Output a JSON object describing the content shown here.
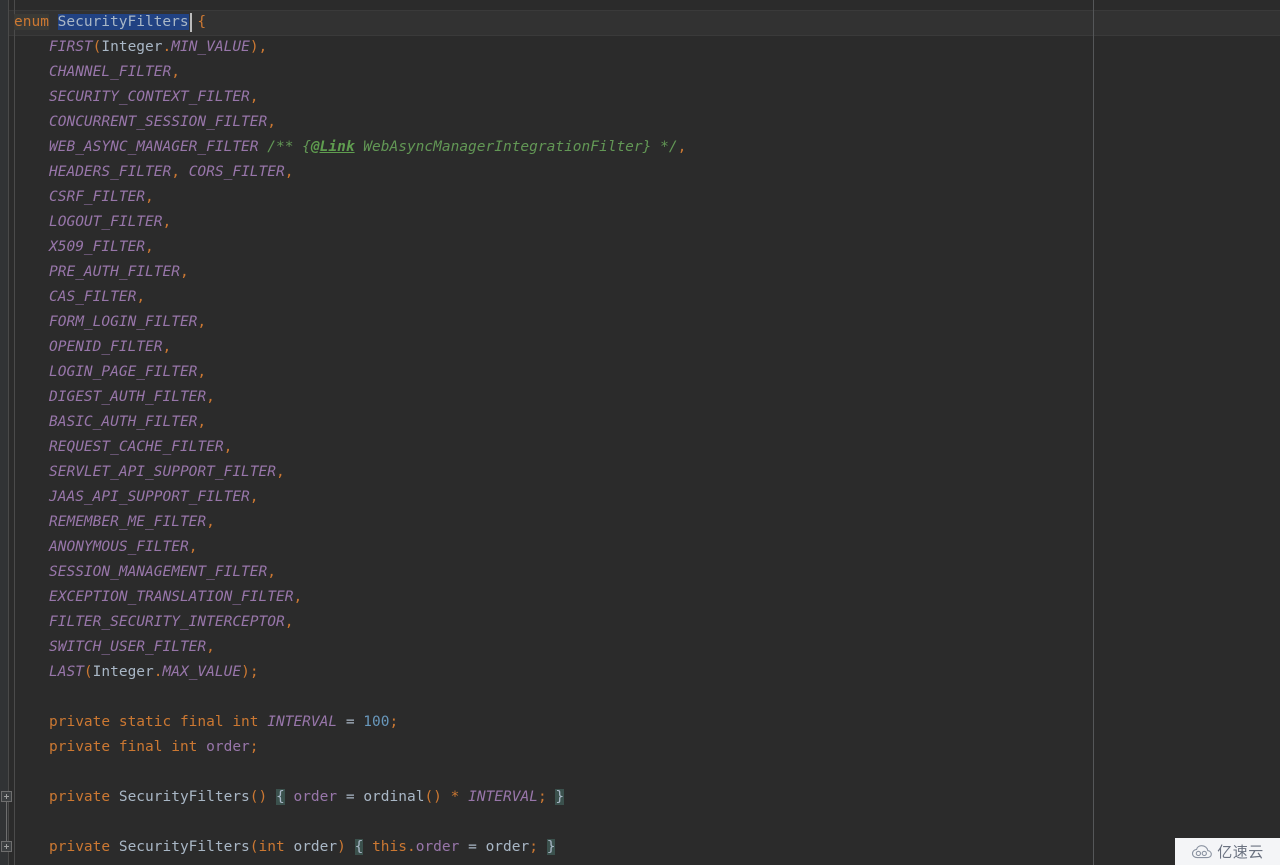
{
  "editor": {
    "language": "Java",
    "theme": "Darcula",
    "background_color": "#2b2b2b",
    "gutter_color": "#313335",
    "caret_line_color": "#323232",
    "selection_color": "#214283",
    "default_text_color": "#a9b7c6",
    "keyword_color": "#cc7832",
    "constant_color": "#9876aa",
    "number_color": "#6897bb",
    "comment_color": "#629755",
    "javadoc_tag_color": "#5f9d4f"
  },
  "declaration": {
    "keyword": "enum",
    "type_name": "SecurityFilters",
    "open_brace": "{",
    "selected_text": "SecurityFilters"
  },
  "enum_constants": [
    {
      "name": "FIRST",
      "args_prefix": "(",
      "arg_class": "Integer",
      "arg_dot": ".",
      "arg_const": "MIN_VALUE",
      "args_suffix": ")",
      "separator": ","
    },
    {
      "name": "CHANNEL_FILTER",
      "separator": ","
    },
    {
      "name": "SECURITY_CONTEXT_FILTER",
      "separator": ","
    },
    {
      "name": "CONCURRENT_SESSION_FILTER",
      "separator": ","
    },
    {
      "name": "WEB_ASYNC_MANAGER_FILTER",
      "comment_open": "/** {",
      "comment_tag": "@Link",
      "comment_body": " WebAsyncManagerIntegrationFilter",
      "comment_close": "} */",
      "separator": ","
    },
    {
      "name": "HEADERS_FILTER",
      "separator": ",",
      "extra_name": "CORS_FILTER",
      "extra_separator": ","
    },
    {
      "name": "CSRF_FILTER",
      "separator": ","
    },
    {
      "name": "LOGOUT_FILTER",
      "separator": ","
    },
    {
      "name": "X509_FILTER",
      "separator": ","
    },
    {
      "name": "PRE_AUTH_FILTER",
      "separator": ","
    },
    {
      "name": "CAS_FILTER",
      "separator": ","
    },
    {
      "name": "FORM_LOGIN_FILTER",
      "separator": ","
    },
    {
      "name": "OPENID_FILTER",
      "separator": ","
    },
    {
      "name": "LOGIN_PAGE_FILTER",
      "separator": ","
    },
    {
      "name": "DIGEST_AUTH_FILTER",
      "separator": ","
    },
    {
      "name": "BASIC_AUTH_FILTER",
      "separator": ","
    },
    {
      "name": "REQUEST_CACHE_FILTER",
      "separator": ","
    },
    {
      "name": "SERVLET_API_SUPPORT_FILTER",
      "separator": ","
    },
    {
      "name": "JAAS_API_SUPPORT_FILTER",
      "separator": ","
    },
    {
      "name": "REMEMBER_ME_FILTER",
      "separator": ","
    },
    {
      "name": "ANONYMOUS_FILTER",
      "separator": ","
    },
    {
      "name": "SESSION_MANAGEMENT_FILTER",
      "separator": ","
    },
    {
      "name": "EXCEPTION_TRANSLATION_FILTER",
      "separator": ","
    },
    {
      "name": "FILTER_SECURITY_INTERCEPTOR",
      "separator": ","
    },
    {
      "name": "SWITCH_USER_FILTER",
      "separator": ","
    },
    {
      "name": "LAST",
      "args_prefix": "(",
      "arg_class": "Integer",
      "arg_dot": ".",
      "arg_const": "MAX_VALUE",
      "args_suffix": ")",
      "separator": ";"
    }
  ],
  "fields": [
    {
      "modifiers": "private static final ",
      "type": "int ",
      "name": "INTERVAL",
      "operator": " = ",
      "value": "100",
      "terminator": ";"
    },
    {
      "modifiers": "private final ",
      "type": "int ",
      "name": "order",
      "terminator": ";"
    }
  ],
  "constructors": [
    {
      "modifier": "private ",
      "name": "SecurityFilters",
      "params_open": "(",
      "params": "",
      "params_close": ")",
      "body_open": "{",
      "body_target": "order",
      "body_operator": " = ",
      "body_call": "ordinal",
      "body_call_parens": "()",
      "body_mult": " * ",
      "body_const": "INTERVAL",
      "body_terminator": ";",
      "body_close": "}"
    },
    {
      "modifier": "private ",
      "name": "SecurityFilters",
      "params_open": "(",
      "param_type": "int",
      "param_name": " order",
      "params_close": ")",
      "body_open": "{",
      "body_this": "this",
      "body_dot": ".",
      "body_field": "order",
      "body_operator": " = ",
      "body_value": "order",
      "body_terminator": ";",
      "body_close": "}"
    }
  ],
  "gutter": {
    "fold_markers": [
      "collapse-method-1",
      "collapse-method-2"
    ]
  },
  "watermark": {
    "text": "亿速云",
    "icon": "cloud-icon",
    "background_color": "#f4f5f7",
    "text_color": "#6b7280"
  }
}
